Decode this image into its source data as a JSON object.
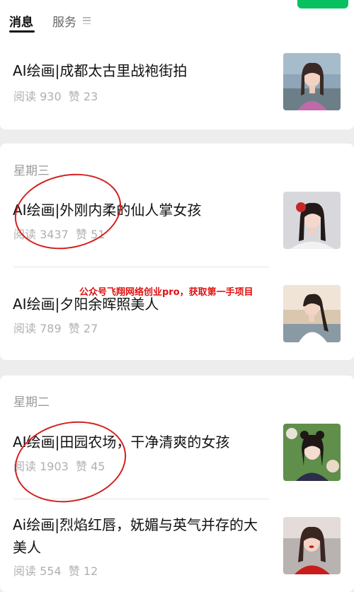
{
  "tabs": {
    "messages": "消息",
    "services": "服务"
  },
  "articles": [
    {
      "title": "AI绘画|成都太古里战袍街拍",
      "meta": "阅读 930  赞 23",
      "image": "woman-portrait-street"
    },
    {
      "title": "AI绘画|外刚内柔的仙人掌女孩",
      "meta": "阅读 3437  赞 51",
      "image": "woman-portrait-red-flower"
    },
    {
      "title": "AI绘画|夕阳余晖照美人",
      "meta": "阅读 789  赞 27",
      "image": "woman-portrait-sunset"
    },
    {
      "title": "AI绘画|田园农场，干净清爽的女孩",
      "meta": "阅读 1903  赞 45",
      "image": "woman-portrait-garden"
    },
    {
      "title": "Ai绘画|烈焰红唇，妩媚与英气并存的大美人",
      "meta": "阅读 554  赞 12",
      "image": "woman-portrait-red-lips"
    }
  ],
  "days": {
    "wednesday": "星期三",
    "tuesday": "星期二"
  },
  "watermark": "公众号飞翔网络创业pro，获取第一手项目",
  "colors": {
    "accent_green": "#07c160",
    "annotation_red": "#d32020",
    "watermark_red": "#e01010"
  }
}
